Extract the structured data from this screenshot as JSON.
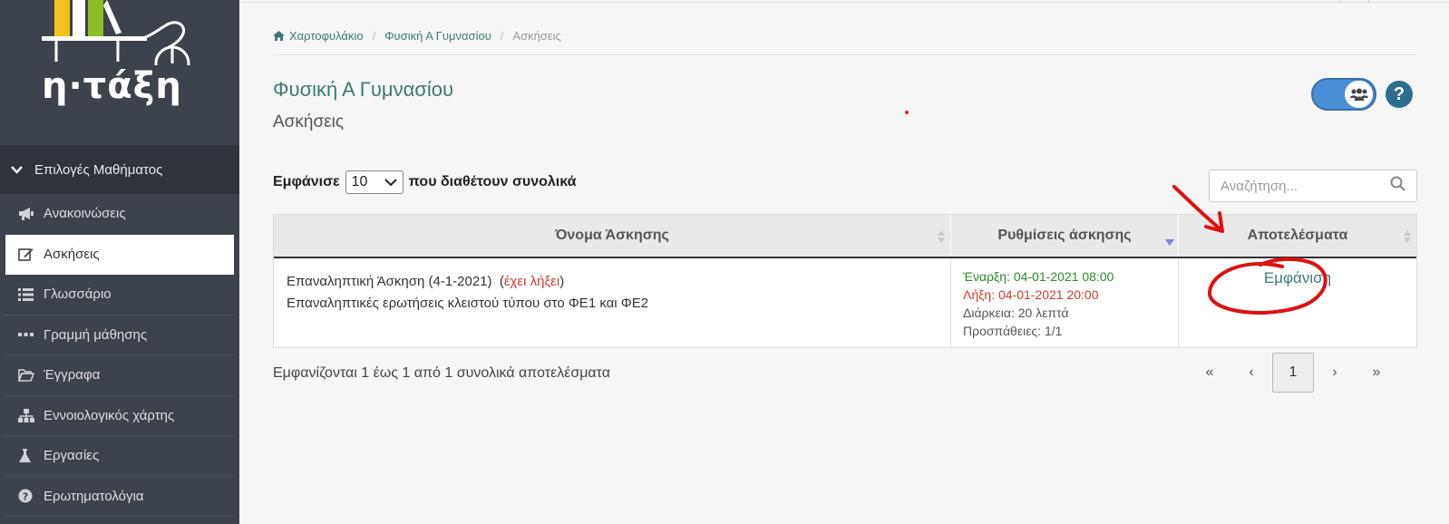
{
  "app": {
    "logo_text": "η·τάξη"
  },
  "sidebar": {
    "options_header": "Επιλογές Μαθήματος",
    "items": [
      {
        "label": "Ανακοινώσεις",
        "icon": "megaphone-icon"
      },
      {
        "label": "Ασκήσεις",
        "icon": "edit-icon"
      },
      {
        "label": "Γλωσσάριο",
        "icon": "list-icon"
      },
      {
        "label": "Γραμμή μάθησης",
        "icon": "ellipsis-icon"
      },
      {
        "label": "Έγγραφα",
        "icon": "folder-open-icon"
      },
      {
        "label": "Εννοιολογικός χάρτης",
        "icon": "sitemap-icon"
      },
      {
        "label": "Εργασίες",
        "icon": "flask-icon"
      },
      {
        "label": "Ερωτηματολόγια",
        "icon": "question-circle-icon"
      }
    ]
  },
  "breadcrumb": {
    "home": "Χαρτοφυλάκιο",
    "course": "Φυσική Α Γυμνασίου",
    "current": "Ασκήσεις"
  },
  "header": {
    "course_title": "Φυσική Α Γυμνασίου",
    "section_title": "Ασκήσεις"
  },
  "controls": {
    "show_prefix": "Εμφάνισε",
    "page_size": "10",
    "show_suffix": "που διαθέτουν συνολικά",
    "search_placeholder": "Αναζήτηση..."
  },
  "table": {
    "headers": [
      "Όνομα Άσκησης",
      "Ρυθμίσεις άσκησης",
      "Αποτελέσματα"
    ],
    "rows": [
      {
        "name": "Επαναληπτική Άσκηση (4-1-2021)",
        "status": "έχει λήξει",
        "description": "Επαναληπτικές ερωτήσεις κλειστού τύπου στο ΦΕ1 και ΦΕ2",
        "start": "Έναρξη: 04-01-2021 08:00",
        "end": "Λήξη: 04-01-2021 20:00",
        "duration": "Διάρκεια: 20 λεπτά",
        "attempts": "Προσπάθειες: 1/1",
        "results_link": "Εμφάνιση"
      }
    ]
  },
  "footer": {
    "info": "Εμφανίζονται 1 έως 1 από 1 συνολικά αποτελέσματα",
    "pager": {
      "first": "«",
      "prev": "‹",
      "current": "1",
      "next": "›",
      "last": "»"
    }
  },
  "colors": {
    "sidebar_bg": "#3d434d",
    "accent": "#3d7a74",
    "expired": "#d23a2a",
    "start": "#2a8a2a",
    "annotation": "#dd1111"
  }
}
